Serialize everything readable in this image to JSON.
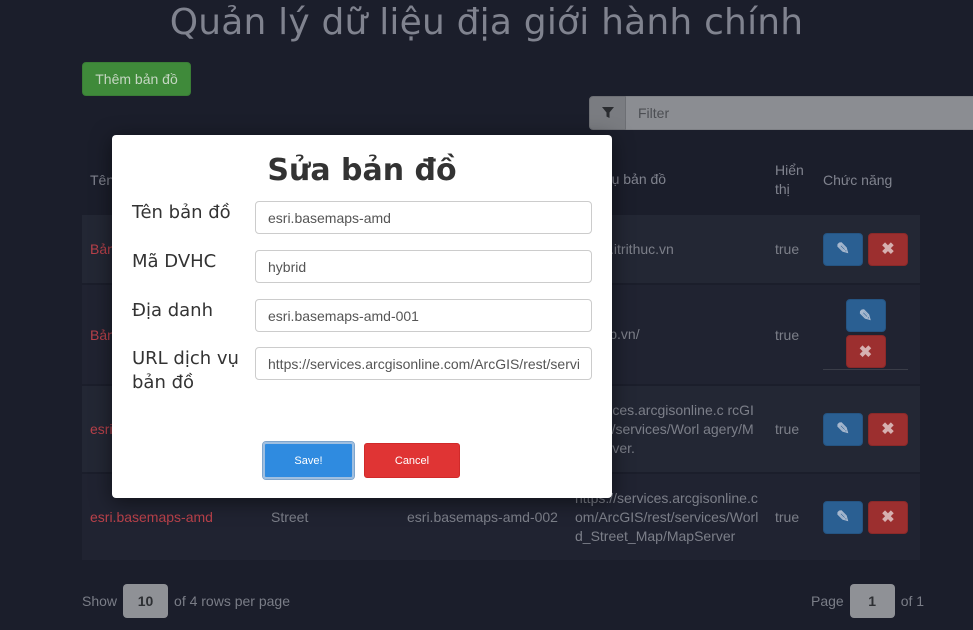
{
  "page": {
    "title": "Quản lý dữ liệu địa giới hành chính"
  },
  "toolbar": {
    "add_label": "Thêm bản đồ"
  },
  "filter": {
    "icon": "filter-icon",
    "placeholder": "Filter"
  },
  "table": {
    "headers": {
      "name": "Tên",
      "url": "dịch vụ bản đồ",
      "show": "Hiển thị",
      "actions": "Chức năng"
    },
    "rows": [
      {
        "name": "Bản",
        "code": "",
        "place": "",
        "url": "//map.itrithuc.vn",
        "show": "true"
      },
      {
        "name": "Bản",
        "code": "",
        "place": "",
        "url": "//vmap.vn/",
        "show": "true"
      },
      {
        "name": "esri",
        "code": "",
        "place": "",
        "url": "//services.arcgisonline.c rcGIS/rest/services/Worl agery/MapServer.",
        "show": "true"
      },
      {
        "name": "esri.basemaps-amd",
        "code": "Street",
        "place": "esri.basemaps-amd-002",
        "url": "https://services.arcgisonline.com/ArcGIS/rest/services/World_Street_Map/MapServer",
        "show": "true"
      }
    ]
  },
  "pager": {
    "show_label": "Show",
    "page_size": "10",
    "rows_text": "of 4 rows per page",
    "page_label": "Page",
    "page": "1",
    "of_text": "of 1"
  },
  "modal": {
    "title": "Sửa bản đồ",
    "fields": [
      {
        "label": "Tên bản đồ",
        "value": "esri.basemaps-amd"
      },
      {
        "label": "Mã DVHC",
        "value": "hybrid"
      },
      {
        "label": "Địa danh",
        "value": "esri.basemaps-amd-001"
      },
      {
        "label": "URL dịch vụ bản đồ",
        "value": "https://services.arcgisonline.com/ArcGIS/rest/services/World_Imagery/MapServer"
      }
    ],
    "save_label": "Save!",
    "cancel_label": "Cancel"
  },
  "colors": {
    "background": "#1b1e2b",
    "add_button": "#3f8a3a",
    "edit_button": "#2a5f92",
    "delete_button": "#9c2f2f",
    "save_button": "#2f8be0",
    "cancel_button": "#e03434",
    "name_link": "#b9414a"
  }
}
